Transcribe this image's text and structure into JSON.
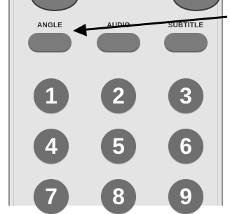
{
  "function_buttons": [
    {
      "label": "ANGLE"
    },
    {
      "label": "AUDIO"
    },
    {
      "label": "SUBTITLE"
    }
  ],
  "number_pad": [
    "1",
    "2",
    "3",
    "4",
    "5",
    "6",
    "7",
    "8",
    "9"
  ],
  "colors": {
    "remote_body": "#e4e4e4",
    "button_fill": "#7b7b7b",
    "digit_text": "#ffffff",
    "callout_arrow": "#000000"
  }
}
